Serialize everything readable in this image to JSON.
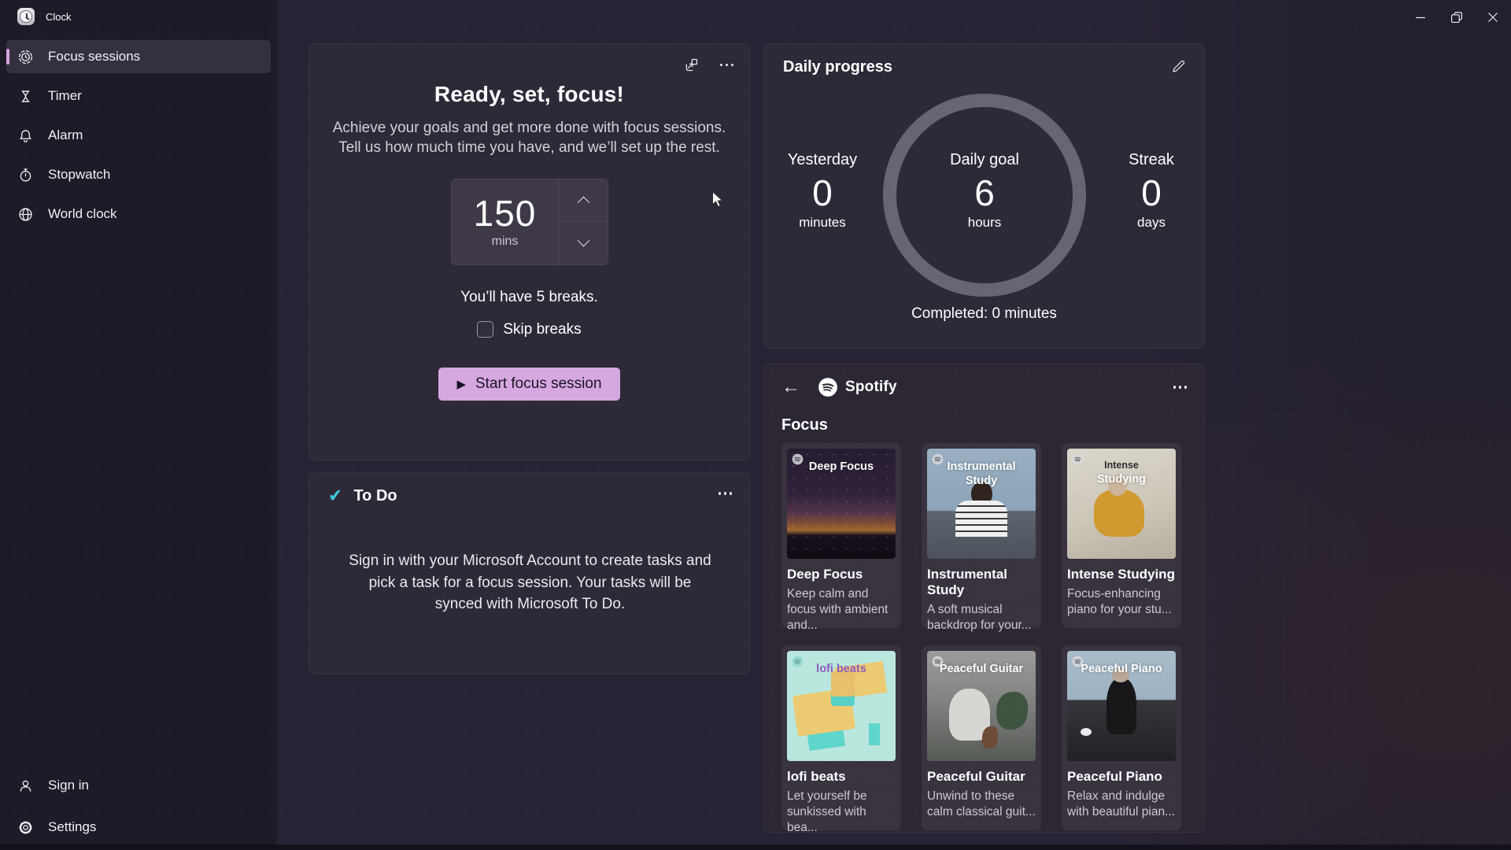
{
  "window": {
    "title": "Clock"
  },
  "sidebar": {
    "items": [
      {
        "label": "Focus sessions",
        "selected": true
      },
      {
        "label": "Timer"
      },
      {
        "label": "Alarm"
      },
      {
        "label": "Stopwatch"
      },
      {
        "label": "World clock"
      }
    ],
    "footer": [
      {
        "label": "Sign in"
      },
      {
        "label": "Settings"
      }
    ]
  },
  "focus_card": {
    "title": "Ready, set, focus!",
    "subtitle": "Achieve your goals and get more done with focus sessions. Tell us how much time you have, and we’ll set up the rest.",
    "stepper": {
      "value": "150",
      "unit": "mins"
    },
    "breaks_note": "You’ll have 5 breaks.",
    "skip_breaks_label": "Skip breaks",
    "start_button": "Start focus session"
  },
  "todo_card": {
    "title": "To Do",
    "body": "Sign in with your Microsoft Account to create tasks and pick a task for a focus session. Your tasks will be synced with Microsoft To Do."
  },
  "daily_progress": {
    "title": "Daily progress",
    "yesterday": {
      "label": "Yesterday",
      "value": "0",
      "unit": "minutes"
    },
    "goal": {
      "label": "Daily goal",
      "value": "6",
      "unit": "hours"
    },
    "streak": {
      "label": "Streak",
      "value": "0",
      "unit": "days"
    },
    "completed": "Completed: 0 minutes"
  },
  "spotify": {
    "brand": "Spotify",
    "section": "Focus",
    "tiles": [
      {
        "art_lines": [
          "Deep Focus"
        ],
        "title": "Deep Focus",
        "desc": "Keep calm and focus with ambient and..."
      },
      {
        "art_lines": [
          "Instrumental",
          "Study"
        ],
        "title": "Instrumental Study",
        "desc": "A soft musical backdrop for your..."
      },
      {
        "art_lines": [
          "Intense",
          "Studying"
        ],
        "title": "Intense Studying",
        "desc": "Focus-enhancing piano for your stu..."
      },
      {
        "art_lines": [
          "lofi beats"
        ],
        "title": "lofi beats",
        "desc": "Let yourself be sunkissed with bea..."
      },
      {
        "art_lines": [
          "Peaceful Guitar"
        ],
        "title": "Peaceful Guitar",
        "desc": "Unwind to these calm classical guit..."
      },
      {
        "art_lines": [
          "Peaceful Piano"
        ],
        "title": "Peaceful Piano",
        "desc": "Relax and indulge with beautiful pian..."
      }
    ]
  },
  "icons": {
    "play": "▶",
    "todo_check": "✔",
    "back_arrow": "←"
  },
  "colors": {
    "accent_button": "#d6a7e1",
    "sidebar_accent": "#d8a3de",
    "ring": "#696471",
    "todo_check": "#41c8dc",
    "card_bg": "#2e2937",
    "sidebar_bg": "#1e1a27",
    "main_bg": "#282334"
  }
}
